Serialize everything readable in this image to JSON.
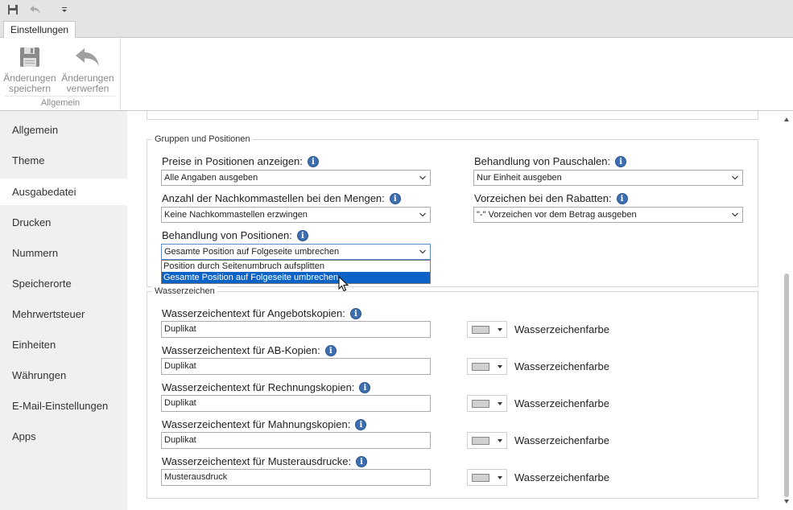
{
  "ribbon": {
    "tab": "Einstellungen",
    "save_label_1": "Änderungen",
    "save_label_2": "speichern",
    "discard_label_1": "Änderungen",
    "discard_label_2": "verwerfen",
    "group_label": "Allgemein"
  },
  "sidebar": {
    "items": [
      {
        "label": "Allgemein"
      },
      {
        "label": "Theme"
      },
      {
        "label": "Ausgabedatei"
      },
      {
        "label": "Drucken"
      },
      {
        "label": "Nummern"
      },
      {
        "label": "Speicherorte"
      },
      {
        "label": "Mehrwertsteuer"
      },
      {
        "label": "Einheiten"
      },
      {
        "label": "Währungen"
      },
      {
        "label": "E-Mail-Einstellungen"
      },
      {
        "label": "Apps"
      }
    ],
    "active": "Ausgabedatei"
  },
  "groups": {
    "title": "Gruppen und Positionen",
    "prices_label": "Preise in Positionen anzeigen:",
    "prices_value": "Alle Angaben ausgeben",
    "flatrate_label": "Behandlung von Pauschalen:",
    "flatrate_value": "Nur Einheit ausgeben",
    "decimals_label": "Anzahl der Nachkommastellen bei den Mengen:",
    "decimals_value": "Keine Nachkommastellen erzwingen",
    "discount_label": "Vorzeichen bei den Rabatten:",
    "discount_value": "\"-\" Vorzeichen vor dem Betrag ausgeben",
    "positions_label": "Behandlung von Positionen:",
    "positions_value": "Gesamte Position auf Folgeseite umbrechen",
    "positions_options": [
      "Position durch Seitenumbruch aufsplitten",
      "Gesamte Position auf Folgeseite umbrechen"
    ]
  },
  "watermark": {
    "title": "Wasserzeichen",
    "rows": [
      {
        "label": "Wasserzeichentext für Angebotskopien:",
        "value": "Duplikat",
        "color_label": "Wasserzeichenfarbe"
      },
      {
        "label": "Wasserzeichentext für AB-Kopien:",
        "value": "Duplikat",
        "color_label": "Wasserzeichenfarbe"
      },
      {
        "label": "Wasserzeichentext für Rechnungskopien:",
        "value": "Duplikat",
        "color_label": "Wasserzeichenfarbe"
      },
      {
        "label": "Wasserzeichentext für Mahnungskopien:",
        "value": "Duplikat",
        "color_label": "Wasserzeichenfarbe"
      },
      {
        "label": "Wasserzeichentext für Musterausdrucke:",
        "value": "Musterausdruck",
        "color_label": "Wasserzeichenfarbe"
      }
    ],
    "swatch_color": "#d0d0d0"
  },
  "colors": {
    "accent": "#0b63c8",
    "info_icon": "#3d6fb0"
  }
}
